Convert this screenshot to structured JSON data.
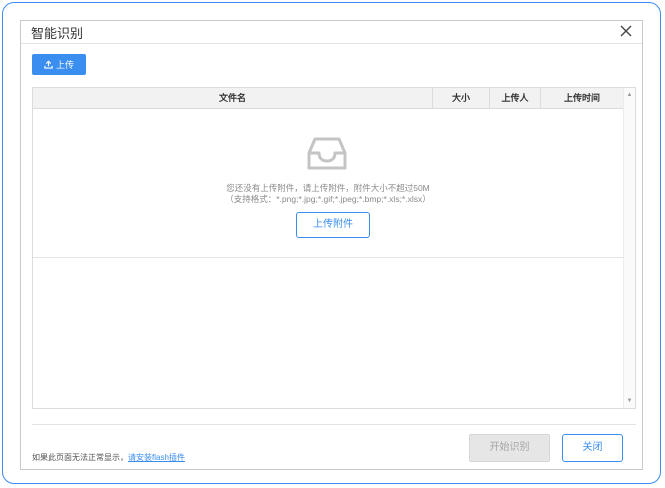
{
  "dialog": {
    "title": "智能识别",
    "close_icon": "close-icon"
  },
  "toolbar": {
    "upload_label": "上传",
    "upload_icon": "upload-icon"
  },
  "table": {
    "columns": [
      "文件名",
      "大小",
      "上传人",
      "上传时间"
    ],
    "empty": {
      "icon": "inbox-icon",
      "message_line1": "您还没有上传附件，请上传附件，附件大小不超过50M",
      "message_line2": "（支持格式：*.png;*.jpg;*.gif;*.jpeg;*.bmp;*.xls;*.xlsx）",
      "attach_button": "上传附件"
    }
  },
  "footer": {
    "note_prefix": "如果此页面无法正常显示，",
    "note_link": "请安装flash插件",
    "start_button": "开始识别",
    "close_button": "关闭"
  },
  "colors": {
    "accent": "#3a8ef0",
    "frame_border": "#3b8df2",
    "disabled_bg": "#e6e6e6"
  }
}
